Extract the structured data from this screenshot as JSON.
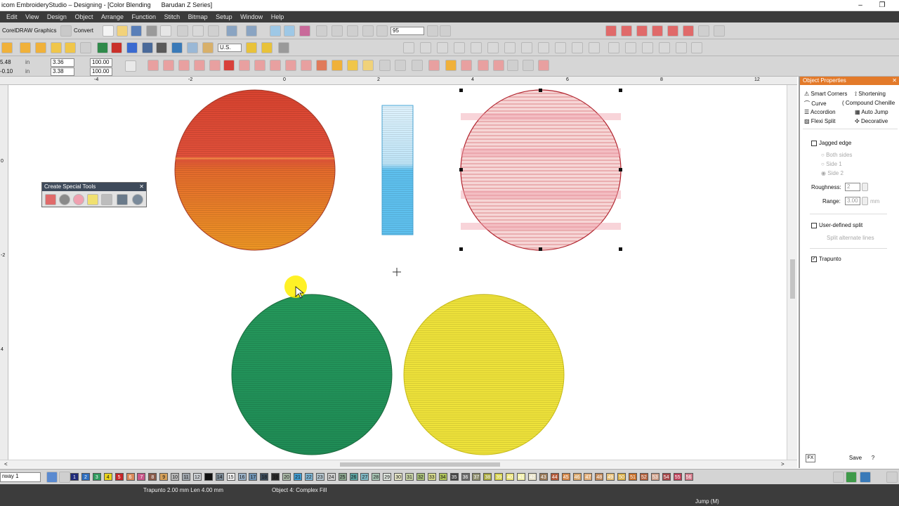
{
  "window": {
    "title": "icom EmbroideryStudio – Designing - [Color Blending",
    "subtitle": "Barudan Z Series]"
  },
  "menu": [
    "Edit",
    "View",
    "Design",
    "Object",
    "Arrange",
    "Function",
    "Stitch",
    "Bitmap",
    "Setup",
    "Window",
    "Help"
  ],
  "toolbar1": {
    "coreldraw_label": "CorelDRAW Graphics",
    "convert_label": "Convert",
    "zoom_value": "95"
  },
  "toolbar2": {
    "units_value": "U.S."
  },
  "toolbar3": {
    "x_value": "5.48",
    "y_value": "-0.10",
    "w_value": "3.36",
    "h_value": "3.38",
    "sx_value": "100.00",
    "sy_value": "100.00"
  },
  "ruler_top": [
    "-4",
    "-2",
    "0",
    "2",
    "4",
    "6",
    "8",
    "10",
    "12"
  ],
  "ruler_left": [
    "-2",
    "0",
    "2",
    "4"
  ],
  "floating_toolbar": {
    "title": "Create Special Tools",
    "close": "✕"
  },
  "object_properties": {
    "title": "Object Properties",
    "effects": [
      {
        "label": "Smart Corners",
        "icon": "smart-corners-icon"
      },
      {
        "label": "Shortening",
        "icon": "shortening-icon"
      },
      {
        "label": "Curve",
        "icon": "curve-icon"
      },
      {
        "label": "Compound Chenille",
        "icon": "chenille-icon"
      },
      {
        "label": "Accordion",
        "icon": "accordion-icon"
      },
      {
        "label": "Auto Jump",
        "icon": "auto-jump-icon"
      },
      {
        "label": "Flexi Split",
        "icon": "flexi-split-icon"
      },
      {
        "label": "Decorative",
        "icon": "decorative-icon"
      }
    ],
    "jagged_edge": {
      "label": "Jagged edge",
      "checked": false
    },
    "sides": [
      "Both sides",
      "Side 1",
      "Side 2"
    ],
    "roughness": {
      "label": "Roughness:",
      "value": "2"
    },
    "range": {
      "label": "Range:",
      "value": "3.00",
      "unit": "mm"
    },
    "user_defined_split": {
      "label": "User-defined split",
      "checked": false
    },
    "split_alternate": "Split alternate lines",
    "trapunto": {
      "label": "Trapunto",
      "checked": true
    },
    "fx_label": "FX",
    "save_label": "Save",
    "help_label": "?"
  },
  "colorbar": {
    "hoop_value": "rway 1",
    "swatches": [
      {
        "n": "1",
        "color": "#1f2a7a"
      },
      {
        "n": "2",
        "color": "#2f6fc0"
      },
      {
        "n": "3",
        "color": "#2f9a5e"
      },
      {
        "n": "4",
        "color": "#e8d21c"
      },
      {
        "n": "5",
        "color": "#c7262a"
      },
      {
        "n": "6",
        "color": "#d98a5c"
      },
      {
        "n": "7",
        "color": "#c9578a"
      },
      {
        "n": "8",
        "color": "#8a5a4a"
      },
      {
        "n": "9",
        "color": "#d6a15a"
      },
      {
        "n": "10",
        "color": "#b9b9b9"
      },
      {
        "n": "11",
        "color": "#9fa6ad"
      },
      {
        "n": "12",
        "color": "#cfd3d7"
      },
      {
        "n": "13",
        "color": "#111111"
      },
      {
        "n": "14",
        "color": "#7c8a96"
      },
      {
        "n": "15",
        "color": "#f2f2f2"
      },
      {
        "n": "16",
        "color": "#9bb2c8"
      },
      {
        "n": "17",
        "color": "#6f93b3"
      },
      {
        "n": "18",
        "color": "#3b4b5a"
      },
      {
        "n": "19",
        "color": "#2a2a2a"
      },
      {
        "n": "20",
        "color": "#a9b8a6"
      },
      {
        "n": "21",
        "color": "#3f9cd2"
      },
      {
        "n": "22",
        "color": "#7fb7d6"
      },
      {
        "n": "23",
        "color": "#b6c7d1"
      },
      {
        "n": "24",
        "color": "#d1d1d1"
      },
      {
        "n": "25",
        "color": "#8aa58e"
      },
      {
        "n": "26",
        "color": "#5aa2a0"
      },
      {
        "n": "27",
        "color": "#7fb9c5"
      },
      {
        "n": "28",
        "color": "#a7c5b4"
      },
      {
        "n": "29",
        "color": "#dfe6df"
      },
      {
        "n": "30",
        "color": "#e6e6c6"
      },
      {
        "n": "31",
        "color": "#c8d4a6"
      },
      {
        "n": "32",
        "color": "#a9c07a"
      },
      {
        "n": "33",
        "color": "#d7dc8c"
      },
      {
        "n": "34",
        "color": "#b0c55a"
      },
      {
        "n": "35",
        "color": "#444444"
      },
      {
        "n": "36",
        "color": "#6a6a6a"
      },
      {
        "n": "37",
        "color": "#8f8f6f"
      },
      {
        "n": "38",
        "color": "#a8a83f"
      },
      {
        "n": "39",
        "color": "#d6d24a"
      },
      {
        "n": "40",
        "color": "#e9e27a"
      },
      {
        "n": "41",
        "color": "#f0eeaa"
      },
      {
        "n": "42",
        "color": "#e7e2c9"
      },
      {
        "n": "43",
        "color": "#9a7a5a"
      },
      {
        "n": "44",
        "color": "#b55a3a"
      },
      {
        "n": "45",
        "color": "#d6884a"
      },
      {
        "n": "46",
        "color": "#d9a66a"
      },
      {
        "n": "47",
        "color": "#e3b07c"
      },
      {
        "n": "48",
        "color": "#c38b5c"
      },
      {
        "n": "49",
        "color": "#e6c07a"
      },
      {
        "n": "50",
        "color": "#d9b04a"
      },
      {
        "n": "51",
        "color": "#c9702a"
      },
      {
        "n": "52",
        "color": "#b5633f"
      },
      {
        "n": "53",
        "color": "#cfa08a"
      },
      {
        "n": "54",
        "color": "#a8484a"
      },
      {
        "n": "55",
        "color": "#c0405a"
      },
      {
        "n": "56",
        "color": "#d37a8a"
      }
    ]
  },
  "status": {
    "stitch_info": "Trapunto  2.00 mm Len  4.00 mm",
    "object_info": "Object 4: Complex Fill",
    "jump_info": "Jump (M)"
  },
  "design_colors": {
    "red": "#d8432f",
    "orange": "#e8891f",
    "blue": "#5ec0ee",
    "pink": "#f0b9bb",
    "green": "#25985a",
    "yellow": "#eee23a",
    "cursor_highlight": "#ffee00"
  }
}
